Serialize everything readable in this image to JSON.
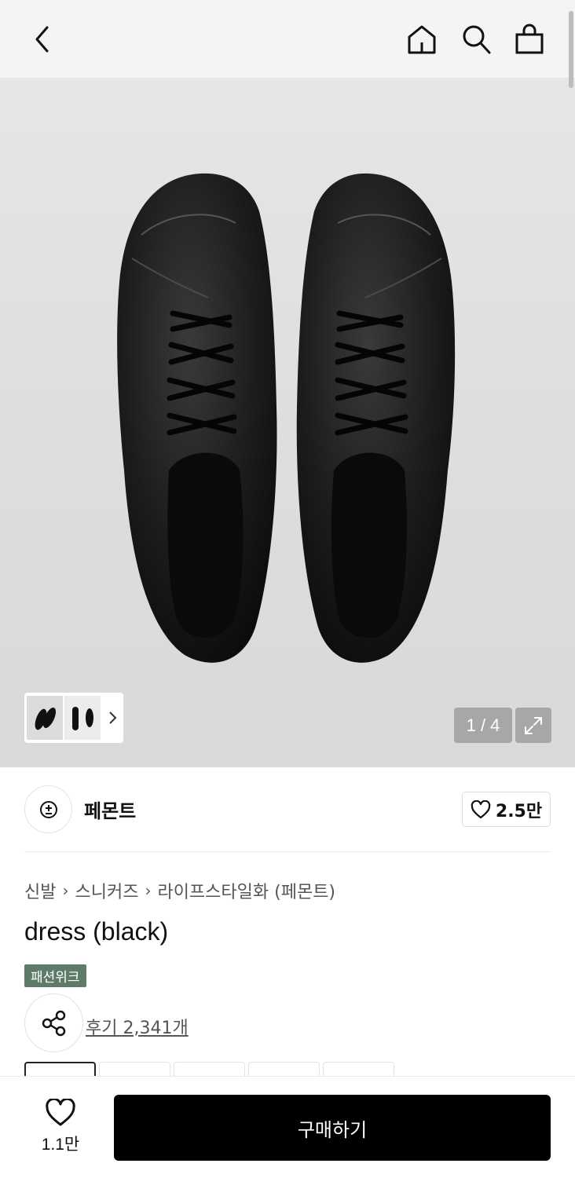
{
  "header": {
    "back_icon": "chevron-left-icon",
    "home_icon": "home-icon",
    "search_icon": "search-icon",
    "cart_icon": "shopping-bag-icon"
  },
  "gallery": {
    "counter": "1 / 4",
    "expand_icon": "expand-icon"
  },
  "brand": {
    "name": "페몬트",
    "likes": "2.5만"
  },
  "breadcrumb": [
    "신발",
    "스니커즈",
    "라이프스타일화 (페몬트)"
  ],
  "product": {
    "title": "dress (black)",
    "tag": "패션위크",
    "reviews": "후기 2,341개"
  },
  "bottom_bar": {
    "likes": "1.1만",
    "buy_label": "구매하기"
  },
  "colors": {
    "tag_bg": "#5e7b69",
    "buy_bg": "#000000"
  }
}
